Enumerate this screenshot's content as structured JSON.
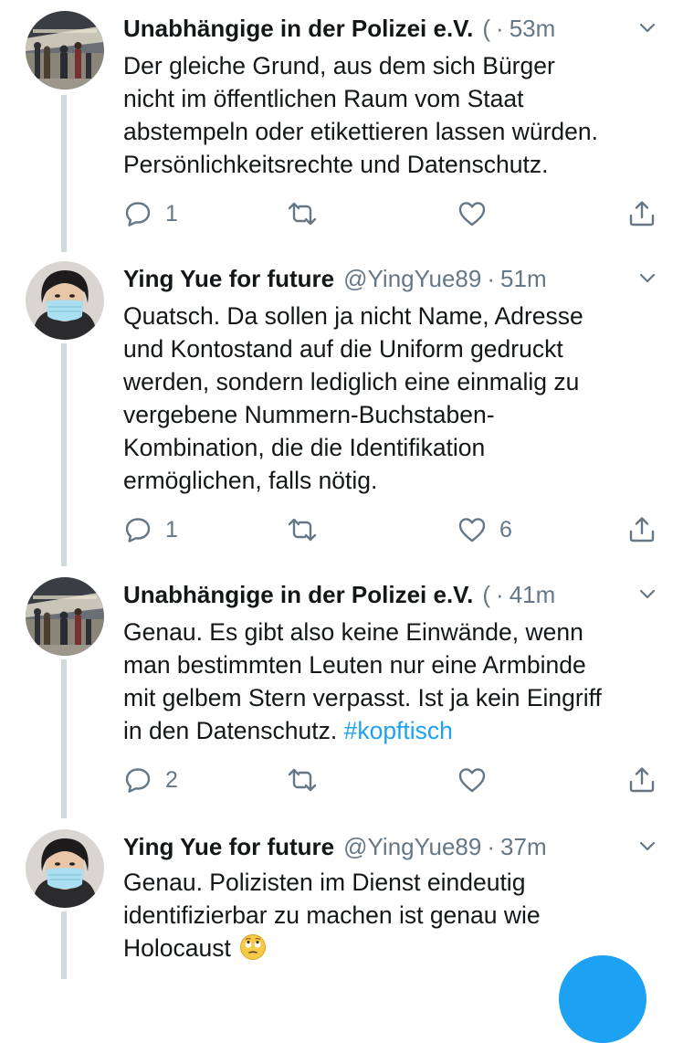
{
  "colors": {
    "accent": "#1da1f2",
    "text_primary": "#14171a",
    "text_secondary": "#657786",
    "thread_line": "#cfd9de"
  },
  "tweets": [
    {
      "author_name": "Unabhängige in der Polizei e.V.",
      "handle": "(",
      "separator": "·",
      "time": "53m",
      "text": "Der gleiche Grund, aus dem sich Bürger\nnicht im öffentlichen Raum vom Staat\nabstempeln oder etikettieren lassen würden.\nPersönlichkeitsrechte und Datenschutz.",
      "reply_count": "1",
      "retweet_count": "",
      "like_count": "",
      "avatar_icon": "station-crowd-avatar"
    },
    {
      "author_name": "Ying Yue for future",
      "handle": "@YingYue89",
      "separator": "·",
      "time": "51m",
      "text": "Quatsch. Da sollen ja nicht Name, Adresse\nund Kontostand auf die Uniform gedruckt\nwerden, sondern lediglich eine einmalig zu\nvergebene Nummern-Buchstaben-\nKombination, die die Identifikation\nermöglichen, falls nötig.",
      "reply_count": "1",
      "retweet_count": "",
      "like_count": "6",
      "avatar_icon": "face-mask-avatar"
    },
    {
      "author_name": "Unabhängige in der Polizei e.V.",
      "handle": "(",
      "separator": "·",
      "time": "41m",
      "text_before_hashtag": "Genau. Es gibt also keine Einwände, wenn\nman bestimmten Leuten nur eine Armbinde\nmit gelbem Stern verpasst. Ist ja kein Eingriff\nin den Datenschutz. ",
      "hashtag": "#kopftisch",
      "reply_count": "2",
      "retweet_count": "",
      "like_count": "",
      "avatar_icon": "station-crowd-avatar"
    },
    {
      "author_name": "Ying Yue for future",
      "handle": "@YingYue89",
      "separator": "·",
      "time": "37m",
      "text": "Genau. Polizisten im Dienst eindeutig\nidentifizierbar zu machen ist genau wie\nHolocaust ",
      "emoji": "face-with-rolling-eyes",
      "avatar_icon": "face-mask-avatar"
    }
  ],
  "icons": {
    "reply": "reply-icon",
    "retweet": "retweet-icon",
    "like": "heart-icon",
    "share": "share-icon",
    "more": "chevron-down-icon",
    "compose": "compose-tweet-button"
  }
}
